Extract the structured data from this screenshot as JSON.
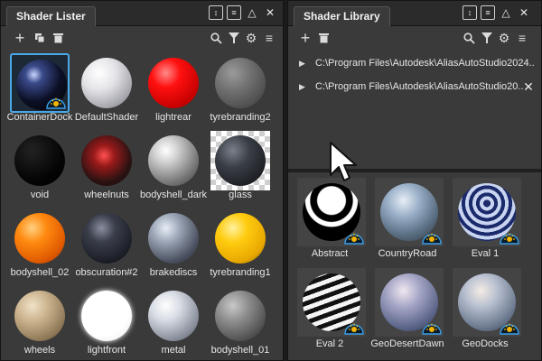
{
  "lister": {
    "title": "Shader Lister",
    "icons": {
      "pin": "pin-icon",
      "menu": "menu-icon",
      "collapse": "collapse-icon",
      "close": "close-icon"
    },
    "toolbar": {
      "new": "plus-icon",
      "copy": "copy-icon",
      "delete": "trash-icon",
      "search": "search-icon",
      "filter": "filter-icon",
      "settings": "gear-icon",
      "options": "menu-icon"
    },
    "shaders": [
      {
        "name": "ContainerDock",
        "selected": true,
        "badge": true
      },
      {
        "name": "DefaultShader"
      },
      {
        "name": "lightrear"
      },
      {
        "name": "tyrebranding2"
      },
      {
        "name": "void"
      },
      {
        "name": "wheelnuts"
      },
      {
        "name": "bodyshell_dark"
      },
      {
        "name": "glass"
      },
      {
        "name": "bodyshell_02"
      },
      {
        "name": "obscuration#2"
      },
      {
        "name": "brakediscs"
      },
      {
        "name": "tyrebranding1"
      },
      {
        "name": "wheels"
      },
      {
        "name": "lightfront"
      },
      {
        "name": "metal"
      },
      {
        "name": "bodyshell_01"
      }
    ]
  },
  "library": {
    "title": "Shader Library",
    "toolbar": {
      "new": "plus-icon",
      "delete": "trash-icon",
      "search": "search-icon",
      "filter": "filter-icon",
      "settings": "gear-icon",
      "options": "menu-icon"
    },
    "paths": [
      {
        "text": "C:\\Program Files\\Autodesk\\AliasAutoStudio2024..."
      },
      {
        "text": "C:\\Program Files\\Autodesk\\AliasAutoStudio20...",
        "removable": true
      }
    ],
    "items": [
      {
        "name": "Abstract"
      },
      {
        "name": "CountryRoad"
      },
      {
        "name": "Eval 1"
      },
      {
        "name": "Eval 2"
      },
      {
        "name": "GeoDesertDawn"
      },
      {
        "name": "GeoDocks"
      }
    ]
  },
  "colors": {
    "accent": "#4aa8e8",
    "panel": "#3a3a3a",
    "titlebar": "#2b2b2b"
  }
}
